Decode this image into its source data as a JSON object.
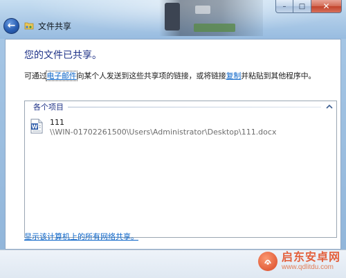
{
  "window": {
    "title": "文件共享",
    "minimize_glyph": "–",
    "maximize_glyph": "□",
    "close_glyph": "✕"
  },
  "nav": {
    "back_glyph": "←"
  },
  "content": {
    "heading": "您的文件已共享。",
    "desc_prefix": "可通过",
    "desc_email_link": "电子邮件",
    "desc_middle": "向某个人发送到这些共享项的链接，或将链接",
    "desc_copy_link": "复制",
    "desc_suffix": "并粘贴到其他程序中。"
  },
  "items_group": {
    "label": "各个项目",
    "items": [
      {
        "name": "111",
        "path": "\\\\WIN-01702261500\\Users\\Administrator\\Desktop\\111.docx",
        "icon": "word-document-icon"
      }
    ]
  },
  "footer": {
    "network_link": "显示该计算机上的所有网络共享。"
  },
  "watermark": {
    "title": "启东安卓网",
    "url": "www.qdlitdu.com"
  },
  "colors": {
    "heading": "#1e3287",
    "link": "#0b64c8",
    "close_button": "#c2432b"
  }
}
